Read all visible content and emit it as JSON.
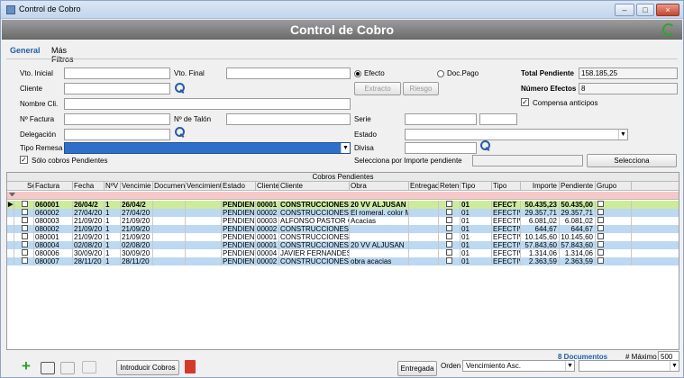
{
  "window": {
    "title": "Control de Cobro",
    "heading": "Control de Cobro",
    "btn_min": "–",
    "btn_max": "□",
    "btn_close": "×"
  },
  "tabs": [
    {
      "label": "General"
    },
    {
      "label": "Más Filtros"
    }
  ],
  "form": {
    "vto_inicial_label": "Vto. Inicial",
    "vto_final_label": "Vto. Final",
    "cliente_label": "Cliente",
    "nombre_cli_label": "Nombre Cli.",
    "nfactura_label": "Nº Factura",
    "ntalon_label": "Nº de Talón",
    "delegacion_label": "Delegación",
    "tipo_remesa_label": "Tipo Remesa",
    "solo_pendientes_label": "Sólo cobros Pendientes",
    "efecto_label": "Efecto",
    "docpago_label": "Doc.Pago",
    "extracto_label": "Extracto",
    "riesgo_label": "Riesgo",
    "serie_label": "Serie",
    "estado_label": "Estado",
    "divisa_label": "Divisa",
    "selecciona_importe_label": "Selecciona por Importe pendiente",
    "selecciona_button": "Selecciona",
    "total_pendiente_label": "Total Pendiente",
    "total_pendiente_value": "158.185,25",
    "numero_efectos_label": "Número Efectos",
    "numero_efectos_value": "8",
    "compensa_label": "Compensa anticipos"
  },
  "grid": {
    "caption": "Cobros Pendientes",
    "columns": [
      "Sele",
      "Factura",
      "Fecha",
      "NºV",
      "Vencimie",
      "Documen",
      "Vencimient",
      "Estado",
      "Cliente",
      "Cliente",
      "Obra",
      "Entregad",
      "Reten",
      "Tipo",
      "Tipo",
      "Importe",
      "Pendiente",
      "Grupo"
    ],
    "rows": [
      {
        "factura": "060001",
        "fecha": "26/04/2",
        "nv": "1",
        "venc": "26/04/2",
        "estado": "PENDIEN",
        "cli": "00001",
        "cliente": "CONSTRUCCIONES",
        "obra": "20 VV ALJUSAN",
        "tipo": "01",
        "tipo2": "EFECT",
        "importe": "50.435,23",
        "pendiente": "50.435,00"
      },
      {
        "factura": "060002",
        "fecha": "27/04/20",
        "nv": "1",
        "venc": "27/04/20",
        "estado": "PENDIENT",
        "cli": "00002",
        "cliente": "CONSTRUCCIONES G",
        "obra": "El romeral. color Ma",
        "tipo": "01",
        "tipo2": "EFECTIV",
        "importe": "29.357,71",
        "pendiente": "29.357,71"
      },
      {
        "factura": "080003",
        "fecha": "21/09/20",
        "nv": "1",
        "venc": "21/09/20",
        "estado": "PENDIENT",
        "cli": "00003",
        "cliente": "ALFONSO PASTOR GI",
        "obra": "Acacias",
        "tipo": "01",
        "tipo2": "EFECTIV",
        "importe": "6.081,02",
        "pendiente": "6.081,02"
      },
      {
        "factura": "080002",
        "fecha": "21/09/20",
        "nv": "1",
        "venc": "21/09/20",
        "estado": "PENDIENT",
        "cli": "00002",
        "cliente": "CONSTRUCCIONES G",
        "obra": "",
        "tipo": "01",
        "tipo2": "EFECTIV",
        "importe": "644,67",
        "pendiente": "644,67"
      },
      {
        "factura": "080001",
        "fecha": "21/09/20",
        "nv": "1",
        "venc": "21/09/20",
        "estado": "PENDIENT",
        "cli": "00001",
        "cliente": "CONSTRUCCIONES Y",
        "obra": "",
        "tipo": "01",
        "tipo2": "EFECTIV",
        "importe": "10.145,60",
        "pendiente": "10.145,60"
      },
      {
        "factura": "080004",
        "fecha": "02/08/20",
        "nv": "1",
        "venc": "02/08/20",
        "estado": "PENDIENT",
        "cli": "00001",
        "cliente": "CONSTRUCCIONES Y",
        "obra": "20 VV ALJUSAN",
        "tipo": "01",
        "tipo2": "EFECTIV",
        "importe": "57.843,60",
        "pendiente": "57.843,60"
      },
      {
        "factura": "080006",
        "fecha": "30/09/20",
        "nv": "1",
        "venc": "30/09/20",
        "estado": "PENDIENT",
        "cli": "00004",
        "cliente": "JAVIER FERNANDES",
        "obra": "",
        "tipo": "01",
        "tipo2": "EFECTIV",
        "importe": "1.314,06",
        "pendiente": "1.314,06"
      },
      {
        "factura": "080007",
        "fecha": "28/11/20",
        "nv": "1",
        "venc": "28/11/20",
        "estado": "PENDIENT",
        "cli": "00002",
        "cliente": "CONSTRUCCIONES G",
        "obra": "obra acacias",
        "tipo": "01",
        "tipo2": "EFECTIV",
        "importe": "2.363,59",
        "pendiente": "2.363,59"
      }
    ]
  },
  "footer": {
    "documentos": "8 Documentos",
    "maximo_label": "# Máximo",
    "maximo_value": "500",
    "introducir_cobros": "Introducir Cobros",
    "entregada": "Entregada",
    "orden_label": "Orden",
    "orden_value": "Vencimiento Asc."
  },
  "colors": {
    "header": "#7f7f7f",
    "selected_row": "#cdeb9b",
    "blue_row": "#bcd8f2",
    "white_row": "#ffffff",
    "accent": "#1f5fa8"
  }
}
